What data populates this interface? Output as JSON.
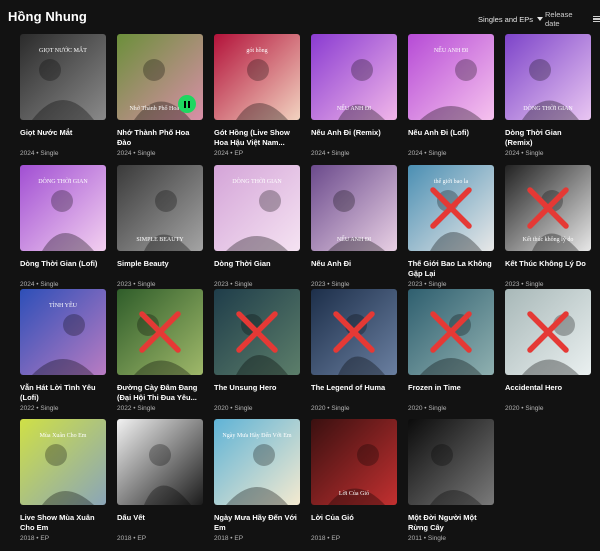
{
  "header": {
    "artist_name": "Hồng Nhung",
    "filter_label": "Singles and EPs",
    "sort_label": "Release date"
  },
  "releases": [
    {
      "title": "Giọt Nước Mắt",
      "year": "2024",
      "type": "Single",
      "available": true,
      "cover_text": "GIỌT NƯỚC MẮT"
    },
    {
      "title": "Nhớ Thành Phố Hoa Đào",
      "year": "2024",
      "type": "Single",
      "available": true,
      "playing": true,
      "cover_text": "Nhớ Thành Phố Hoa Đào"
    },
    {
      "title": "Gót Hồng (Live Show Hoa Hậu Việt Nam...",
      "year": "2024",
      "type": "EP",
      "available": true,
      "cover_text": "gót hồng"
    },
    {
      "title": "Nếu Anh Đi (Remix)",
      "year": "2024",
      "type": "Single",
      "available": true,
      "cover_text": "NẾU ANH ĐI"
    },
    {
      "title": "Nếu Anh Đi (Lofi)",
      "year": "2024",
      "type": "Single",
      "available": true,
      "cover_text": "NẾU ANH ĐI"
    },
    {
      "title": "Dòng Thời Gian (Remix)",
      "year": "2024",
      "type": "Single",
      "available": true,
      "cover_text": "DÒNG THỜI GIAN"
    },
    {
      "title": "Dòng Thời Gian (Lofi)",
      "year": "2024",
      "type": "Single",
      "available": true,
      "cover_text": "DÒNG THỜI GIAN"
    },
    {
      "title": "Simple Beauty",
      "year": "2023",
      "type": "Single",
      "available": true,
      "cover_text": "SIMPLE BEAUTY"
    },
    {
      "title": "Dòng Thời Gian",
      "year": "2023",
      "type": "Single",
      "available": true,
      "cover_text": "DÒNG THỜI GIAN"
    },
    {
      "title": "Nếu Anh Đi",
      "year": "2023",
      "type": "Single",
      "available": true,
      "cover_text": "NẾU ANH ĐI"
    },
    {
      "title": "Thế Giới Bao La Không Gặp Lại",
      "year": "2023",
      "type": "Single",
      "available": false,
      "cover_text": "thế giới bao la"
    },
    {
      "title": "Kết Thúc Không Lý Do",
      "year": "2023",
      "type": "Single",
      "available": false,
      "cover_text": "Kết thúc không lý do"
    },
    {
      "title": "Vẫn Hát Lời Tình Yêu (Lofi)",
      "year": "2022",
      "type": "Single",
      "available": true,
      "cover_text": "TÌNH YÊU"
    },
    {
      "title": "Đường Cày Đâm Đang (Đại Hội Thi Đua Yêu...",
      "year": "2022",
      "type": "Single",
      "available": false,
      "cover_text": ""
    },
    {
      "title": "The Unsung Hero",
      "year": "2020",
      "type": "Single",
      "available": false,
      "cover_text": ""
    },
    {
      "title": "The Legend of Huma",
      "year": "2020",
      "type": "Single",
      "available": false,
      "cover_text": ""
    },
    {
      "title": "Frozen in Time",
      "year": "2020",
      "type": "Single",
      "available": false,
      "cover_text": ""
    },
    {
      "title": "Accidental Hero",
      "year": "2020",
      "type": "Single",
      "available": false,
      "cover_text": ""
    },
    {
      "title": "Live Show Mùa Xuân Cho Em",
      "year": "2018",
      "type": "EP",
      "available": true,
      "cover_text": "Mùa Xuân Cho Em"
    },
    {
      "title": "Dấu Vết",
      "year": "2018",
      "type": "EP",
      "available": true,
      "cover_text": ""
    },
    {
      "title": "Ngày Mưa Hãy Đến Với Em",
      "year": "2018",
      "type": "EP",
      "available": true,
      "cover_text": "Ngày Mưa Hãy Đến Với Em"
    },
    {
      "title": "Lời Của Gió",
      "year": "2018",
      "type": "EP",
      "available": true,
      "cover_text": "Lời Của Gió"
    },
    {
      "title": "Một Đời Người Một Rừng Cây",
      "year": "2011",
      "type": "Single",
      "available": true,
      "cover_text": ""
    }
  ],
  "meta_separator": " • ",
  "colors": {
    "background": "#121212",
    "accent": "#1ed760",
    "unavailable_mark": "#e53935",
    "secondary_text": "#b3b3b3"
  }
}
